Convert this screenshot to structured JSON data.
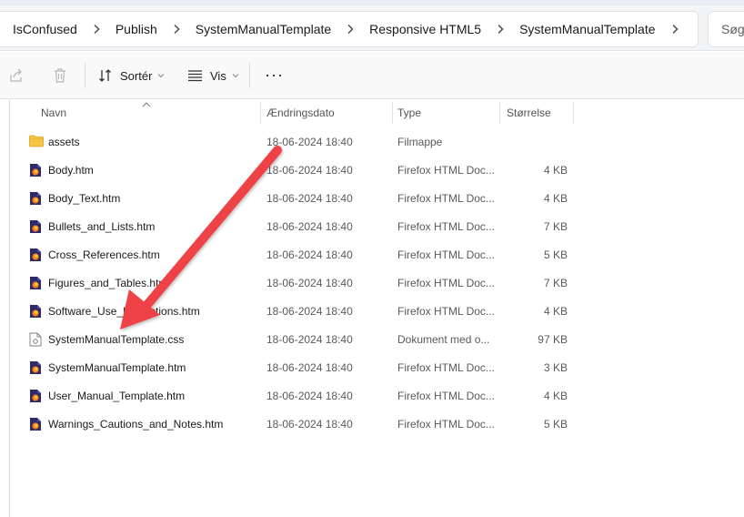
{
  "breadcrumb": {
    "items": [
      "IsConfused",
      "Publish",
      "SystemManualTemplate",
      "Responsive HTML5",
      "SystemManualTemplate"
    ]
  },
  "search": {
    "placeholder": "Søg"
  },
  "toolbar": {
    "sort_label": "Sortér",
    "view_label": "Vis",
    "more_label": "···"
  },
  "columns": {
    "name": "Navn",
    "date": "Ændringsdato",
    "type": "Type",
    "size": "Størrelse"
  },
  "files": [
    {
      "name": "assets",
      "date": "18-06-2024 18:40",
      "type": "Filmappe",
      "size": "",
      "icon": "folder-icon"
    },
    {
      "name": "Body.htm",
      "date": "18-06-2024 18:40",
      "type": "Firefox HTML Doc...",
      "size": "4 KB",
      "icon": "firefox-html-icon"
    },
    {
      "name": "Body_Text.htm",
      "date": "18-06-2024 18:40",
      "type": "Firefox HTML Doc...",
      "size": "4 KB",
      "icon": "firefox-html-icon"
    },
    {
      "name": "Bullets_and_Lists.htm",
      "date": "18-06-2024 18:40",
      "type": "Firefox HTML Doc...",
      "size": "7 KB",
      "icon": "firefox-html-icon"
    },
    {
      "name": "Cross_References.htm",
      "date": "18-06-2024 18:40",
      "type": "Firefox HTML Doc...",
      "size": "5 KB",
      "icon": "firefox-html-icon"
    },
    {
      "name": "Figures_and_Tables.htm",
      "date": "18-06-2024 18:40",
      "type": "Firefox HTML Doc...",
      "size": "7 KB",
      "icon": "firefox-html-icon"
    },
    {
      "name": "Software_Use_Instructions.htm",
      "date": "18-06-2024 18:40",
      "type": "Firefox HTML Doc...",
      "size": "4 KB",
      "icon": "firefox-html-icon"
    },
    {
      "name": "SystemManualTemplate.css",
      "date": "18-06-2024 18:40",
      "type": "Dokument med o...",
      "size": "97 KB",
      "icon": "css-file-icon"
    },
    {
      "name": "SystemManualTemplate.htm",
      "date": "18-06-2024 18:40",
      "type": "Firefox HTML Doc...",
      "size": "3 KB",
      "icon": "firefox-html-icon"
    },
    {
      "name": "User_Manual_Template.htm",
      "date": "18-06-2024 18:40",
      "type": "Firefox HTML Doc...",
      "size": "4 KB",
      "icon": "firefox-html-icon"
    },
    {
      "name": "Warnings_Cautions_and_Notes.htm",
      "date": "18-06-2024 18:40",
      "type": "Firefox HTML Doc...",
      "size": "5 KB",
      "icon": "firefox-html-icon"
    }
  ],
  "colors": {
    "annotation_arrow": "#ef4346",
    "folder": "#f6c544",
    "firefox_html_bg": "#2d2a6b"
  }
}
